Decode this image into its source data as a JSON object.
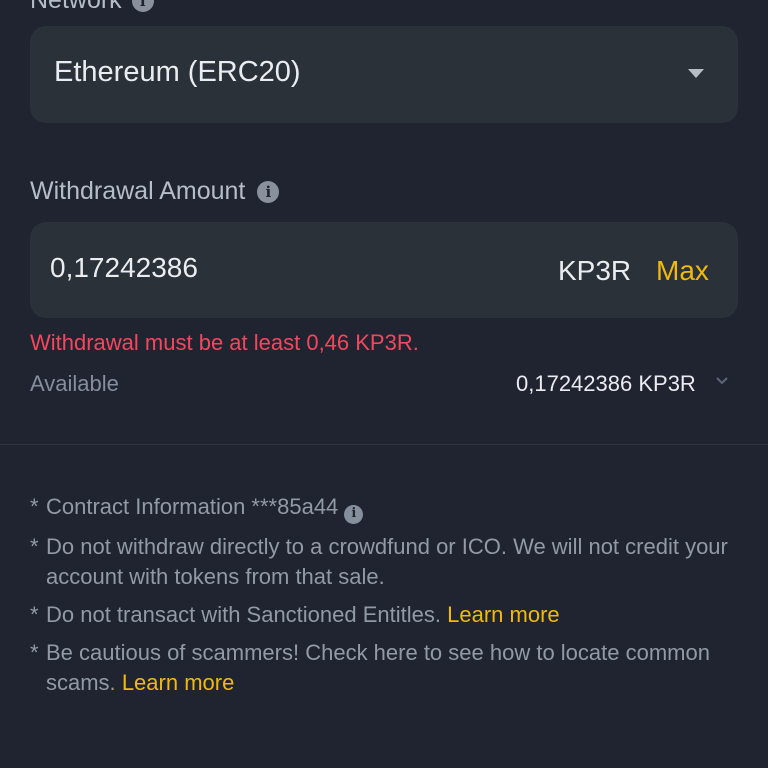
{
  "network": {
    "label": "Network",
    "selected": "Ethereum (ERC20)",
    "info_icon": "info-icon",
    "caret_icon": "caret-down-icon"
  },
  "withdrawal": {
    "label": "Withdrawal Amount",
    "info_icon": "info-icon",
    "amount": "0,17242386",
    "unit": "KP3R",
    "max_label": "Max",
    "error": "Withdrawal must be at least 0,46 KP3R.",
    "available_label": "Available",
    "available_value": "0,17242386 KP3R",
    "available_chevron": "chevron-down-icon"
  },
  "notes": {
    "contract": {
      "star": "*",
      "text": "Contract Information ***85a44",
      "icon": "info-icon"
    },
    "crowdfund": {
      "star": "*",
      "text": "Do not withdraw directly to a crowdfund or ICO. We will not credit your account with tokens from that sale."
    },
    "sanctioned": {
      "star": "*",
      "text": "Do not transact with Sanctioned Entitles.",
      "link": "Learn more"
    },
    "scammers": {
      "star": "*",
      "text": "Be cautious of scammers! Check here to see how to locate common scams.",
      "link": "Learn more"
    }
  },
  "colors": {
    "background": "#1f2430",
    "field": "#2b3139",
    "accent": "#f0b90b",
    "error": "#f6465d",
    "muted": "#848e9c"
  }
}
